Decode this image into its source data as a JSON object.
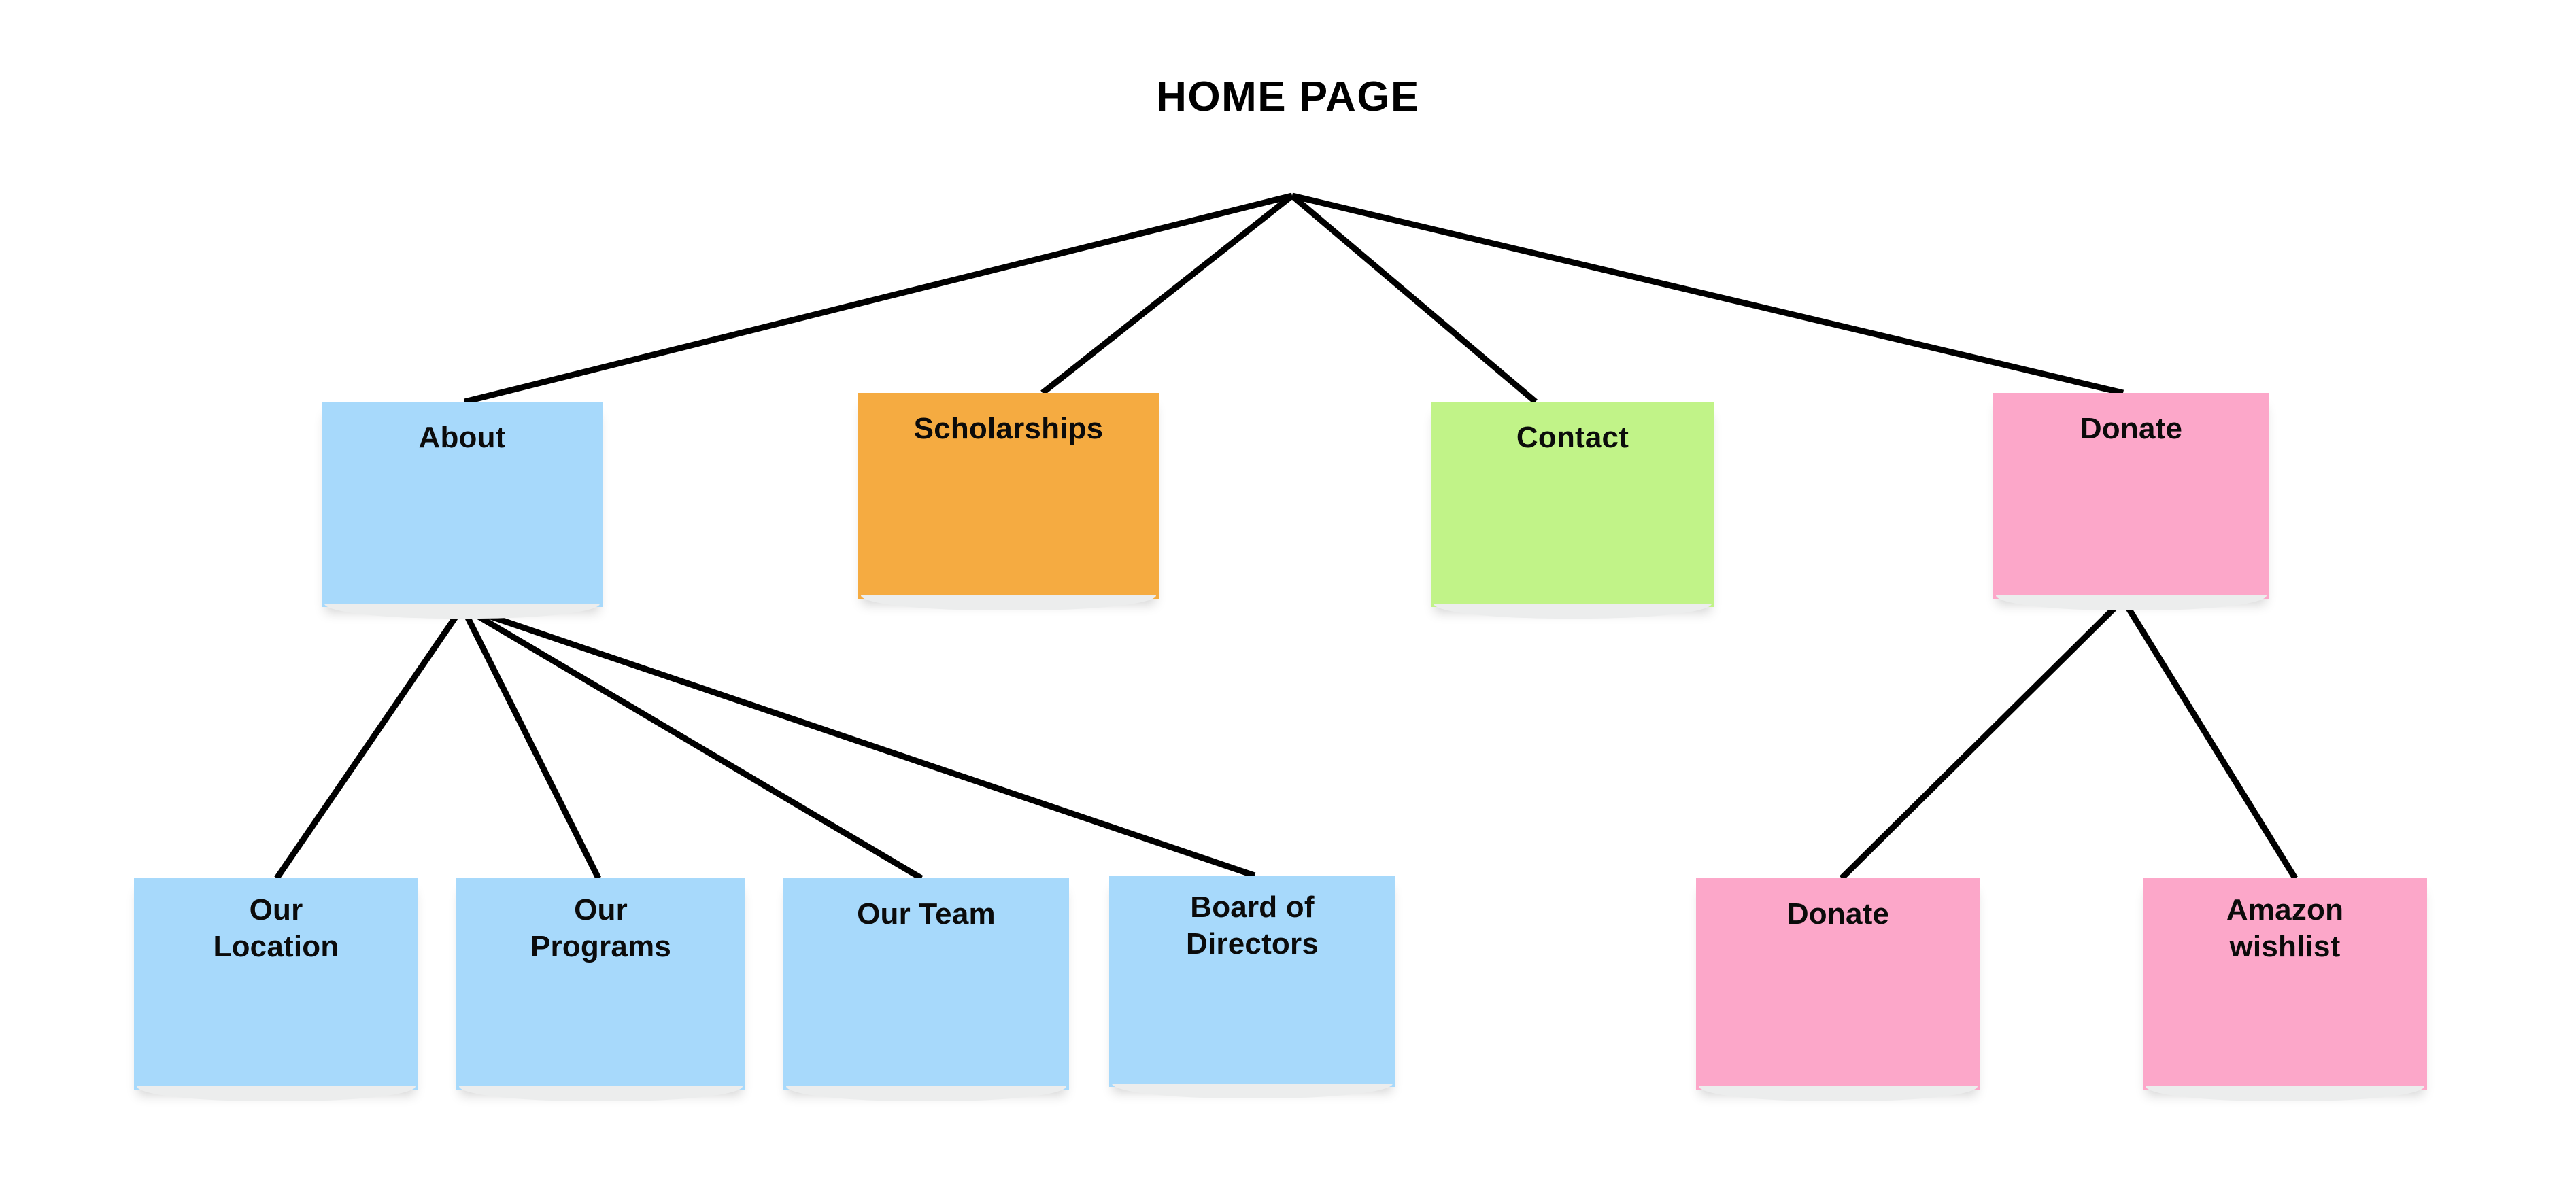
{
  "diagram": {
    "type": "sitemap-tree",
    "title": "HOME PAGE",
    "background": "#ffffff",
    "edge_color": "#000000",
    "text_color": "#0b0b0b",
    "palette": {
      "blue": "#A7D9FB",
      "orange": "#F5AB41",
      "green": "#C1F388",
      "pink": "#FCA7C9"
    },
    "root": {
      "label": "HOME PAGE",
      "children_count": 4
    },
    "level1": [
      {
        "id": "about",
        "label": "About",
        "line1": "About",
        "line2": "",
        "color": "#A7D9FB",
        "children_count": 4
      },
      {
        "id": "scholarships",
        "label": "Scholarships",
        "line1": "Scholarships",
        "line2": "",
        "color": "#F5AB41",
        "children_count": 0
      },
      {
        "id": "contact",
        "label": "Contact",
        "line1": "Contact",
        "line2": "",
        "color": "#C1F388",
        "children_count": 0
      },
      {
        "id": "donate",
        "label": "Donate",
        "line1": "Donate",
        "line2": "",
        "color": "#FCA7C9",
        "children_count": 2
      }
    ],
    "level2_about": [
      {
        "id": "our-location",
        "label": "Our Location",
        "line1": "Our",
        "line2": "Location",
        "color": "#A7D9FB"
      },
      {
        "id": "our-programs",
        "label": "Our Programs",
        "line1": "Our",
        "line2": "Programs",
        "color": "#A7D9FB"
      },
      {
        "id": "our-team",
        "label": "Our Team",
        "line1": "Our Team",
        "line2": "",
        "color": "#A7D9FB"
      },
      {
        "id": "board-of-directors",
        "label": "Board of Directors",
        "line1": "Board of",
        "line2": "Directors",
        "color": "#A7D9FB"
      }
    ],
    "level2_donate": [
      {
        "id": "donate-child",
        "label": "Donate",
        "line1": "Donate",
        "line2": "",
        "color": "#FCA7C9"
      },
      {
        "id": "amazon-wishlist",
        "label": "Amazon wishlist",
        "line1": "Amazon",
        "line2": "wishlist",
        "color": "#FCA7C9"
      }
    ]
  }
}
